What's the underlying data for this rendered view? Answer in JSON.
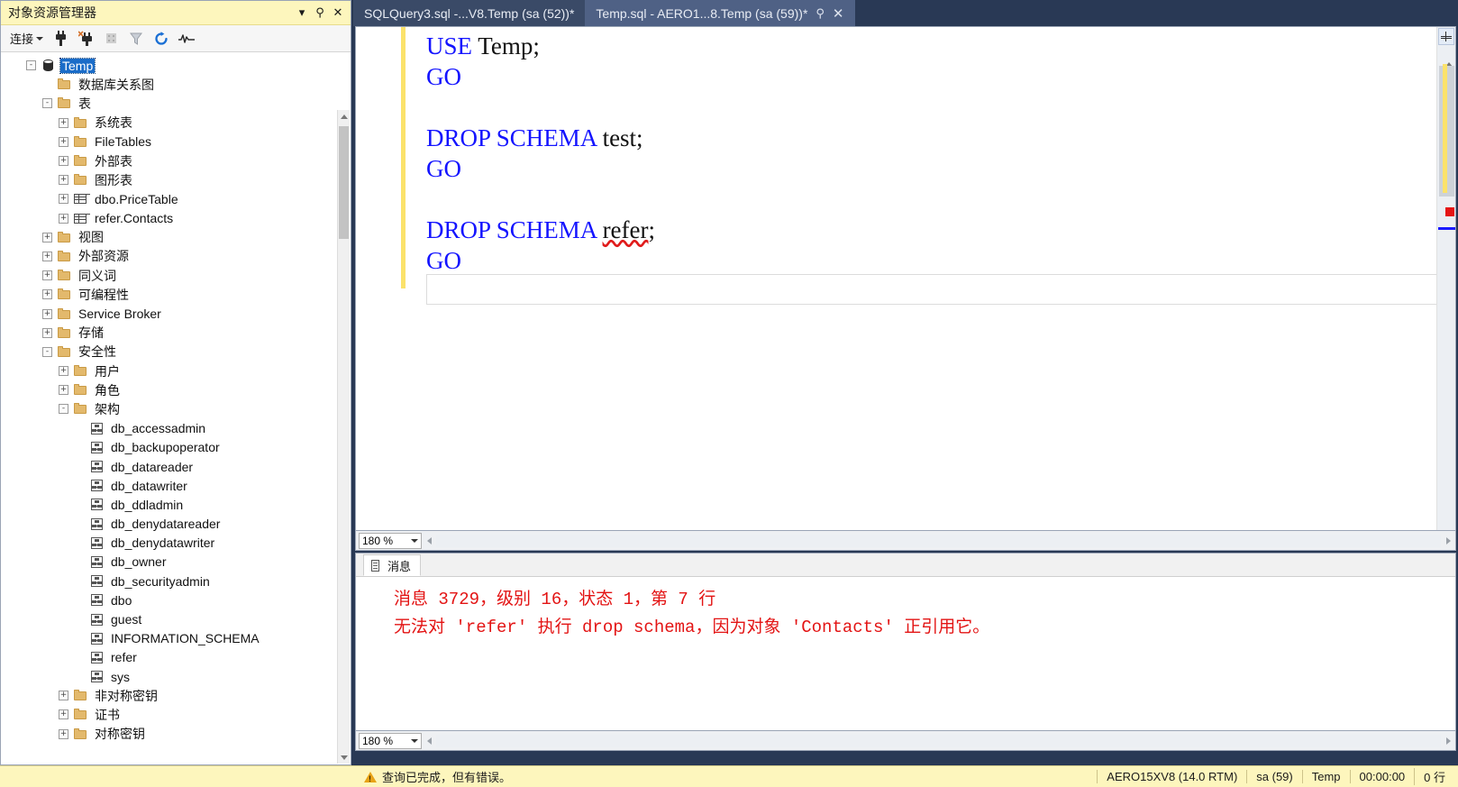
{
  "object_explorer": {
    "title": "对象资源管理器",
    "title_buttons": [
      {
        "name": "dropdown",
        "glyph": "▾"
      },
      {
        "name": "pin",
        "glyph": "⚲"
      },
      {
        "name": "close",
        "glyph": "✕"
      }
    ],
    "toolbar": {
      "connect_label": "连接",
      "buttons": [
        "connect-icon",
        "disconnect-icon",
        "stop-icon",
        "filter-icon",
        "refresh-icon",
        "activity-monitor-icon"
      ]
    },
    "tree": [
      {
        "label": "Temp",
        "indent": 0,
        "expander": "-",
        "icon": "db",
        "selected": true
      },
      {
        "label": "数据库关系图",
        "indent": 1,
        "expander": "",
        "icon": "folder",
        "selected": false
      },
      {
        "label": "表",
        "indent": 1,
        "expander": "-",
        "icon": "folder",
        "selected": false
      },
      {
        "label": "系统表",
        "indent": 2,
        "expander": "+",
        "icon": "folder",
        "selected": false
      },
      {
        "label": "FileTables",
        "indent": 2,
        "expander": "+",
        "icon": "folder",
        "selected": false
      },
      {
        "label": "外部表",
        "indent": 2,
        "expander": "+",
        "icon": "folder",
        "selected": false
      },
      {
        "label": "图形表",
        "indent": 2,
        "expander": "+",
        "icon": "folder",
        "selected": false
      },
      {
        "label": "dbo.PriceTable",
        "indent": 2,
        "expander": "+",
        "icon": "table",
        "selected": false
      },
      {
        "label": "refer.Contacts",
        "indent": 2,
        "expander": "+",
        "icon": "table",
        "selected": false
      },
      {
        "label": "视图",
        "indent": 1,
        "expander": "+",
        "icon": "folder",
        "selected": false
      },
      {
        "label": "外部资源",
        "indent": 1,
        "expander": "+",
        "icon": "folder",
        "selected": false
      },
      {
        "label": "同义词",
        "indent": 1,
        "expander": "+",
        "icon": "folder",
        "selected": false
      },
      {
        "label": "可编程性",
        "indent": 1,
        "expander": "+",
        "icon": "folder",
        "selected": false
      },
      {
        "label": "Service Broker",
        "indent": 1,
        "expander": "+",
        "icon": "folder",
        "selected": false
      },
      {
        "label": "存储",
        "indent": 1,
        "expander": "+",
        "icon": "folder",
        "selected": false
      },
      {
        "label": "安全性",
        "indent": 1,
        "expander": "-",
        "icon": "folder",
        "selected": false
      },
      {
        "label": "用户",
        "indent": 2,
        "expander": "+",
        "icon": "folder",
        "selected": false
      },
      {
        "label": "角色",
        "indent": 2,
        "expander": "+",
        "icon": "folder",
        "selected": false
      },
      {
        "label": "架构",
        "indent": 2,
        "expander": "-",
        "icon": "folder",
        "selected": false
      },
      {
        "label": "db_accessadmin",
        "indent": 3,
        "expander": "",
        "icon": "schema",
        "selected": false
      },
      {
        "label": "db_backupoperator",
        "indent": 3,
        "expander": "",
        "icon": "schema",
        "selected": false
      },
      {
        "label": "db_datareader",
        "indent": 3,
        "expander": "",
        "icon": "schema",
        "selected": false
      },
      {
        "label": "db_datawriter",
        "indent": 3,
        "expander": "",
        "icon": "schema",
        "selected": false
      },
      {
        "label": "db_ddladmin",
        "indent": 3,
        "expander": "",
        "icon": "schema",
        "selected": false
      },
      {
        "label": "db_denydatareader",
        "indent": 3,
        "expander": "",
        "icon": "schema",
        "selected": false
      },
      {
        "label": "db_denydatawriter",
        "indent": 3,
        "expander": "",
        "icon": "schema",
        "selected": false
      },
      {
        "label": "db_owner",
        "indent": 3,
        "expander": "",
        "icon": "schema",
        "selected": false
      },
      {
        "label": "db_securityadmin",
        "indent": 3,
        "expander": "",
        "icon": "schema",
        "selected": false
      },
      {
        "label": "dbo",
        "indent": 3,
        "expander": "",
        "icon": "schema",
        "selected": false
      },
      {
        "label": "guest",
        "indent": 3,
        "expander": "",
        "icon": "schema",
        "selected": false
      },
      {
        "label": "INFORMATION_SCHEMA",
        "indent": 3,
        "expander": "",
        "icon": "schema",
        "selected": false
      },
      {
        "label": "refer",
        "indent": 3,
        "expander": "",
        "icon": "schema",
        "selected": false
      },
      {
        "label": "sys",
        "indent": 3,
        "expander": "",
        "icon": "schema",
        "selected": false
      },
      {
        "label": "非对称密钥",
        "indent": 2,
        "expander": "+",
        "icon": "folder",
        "selected": false
      },
      {
        "label": "证书",
        "indent": 2,
        "expander": "+",
        "icon": "folder",
        "selected": false
      },
      {
        "label": "对称密钥",
        "indent": 2,
        "expander": "+",
        "icon": "folder",
        "selected": false
      }
    ]
  },
  "tabs": [
    {
      "label": "SQLQuery3.sql -...V8.Temp (sa (52))*",
      "active": false
    },
    {
      "label": "Temp.sql - AERO1...8.Temp (sa (59))*",
      "active": true
    }
  ],
  "tab_icons": {
    "pin": "⚲",
    "close": "✕"
  },
  "editor": {
    "zoom": "180 %",
    "lines": [
      [
        {
          "t": "USE",
          "c": "k"
        },
        {
          "t": " Temp;",
          "c": "p"
        }
      ],
      [
        {
          "t": "GO",
          "c": "k"
        }
      ],
      [],
      [
        {
          "t": "DROP SCHEMA",
          "c": "k"
        },
        {
          "t": " test;",
          "c": "p"
        }
      ],
      [
        {
          "t": "GO",
          "c": "k"
        }
      ],
      [],
      [
        {
          "t": "DROP SCHEMA",
          "c": "k"
        },
        {
          "t": " ",
          "c": "p"
        },
        {
          "t": "refer",
          "c": "squig"
        },
        {
          "t": ";",
          "c": "p"
        }
      ],
      [
        {
          "t": "GO",
          "c": "k"
        }
      ]
    ]
  },
  "results": {
    "tab_label": "消息",
    "zoom": "180 %",
    "messages": [
      "消息 3729，级别 16，状态 1，第 7 行",
      "无法对 'refer' 执行 drop schema，因为对象 'Contacts' 正引用它。"
    ]
  },
  "statusbar": {
    "message": "查询已完成，但有错误。",
    "cells": [
      "AERO15XV8 (14.0 RTM)",
      "sa (59)",
      "Temp",
      "00:00:00",
      "0 行"
    ]
  }
}
